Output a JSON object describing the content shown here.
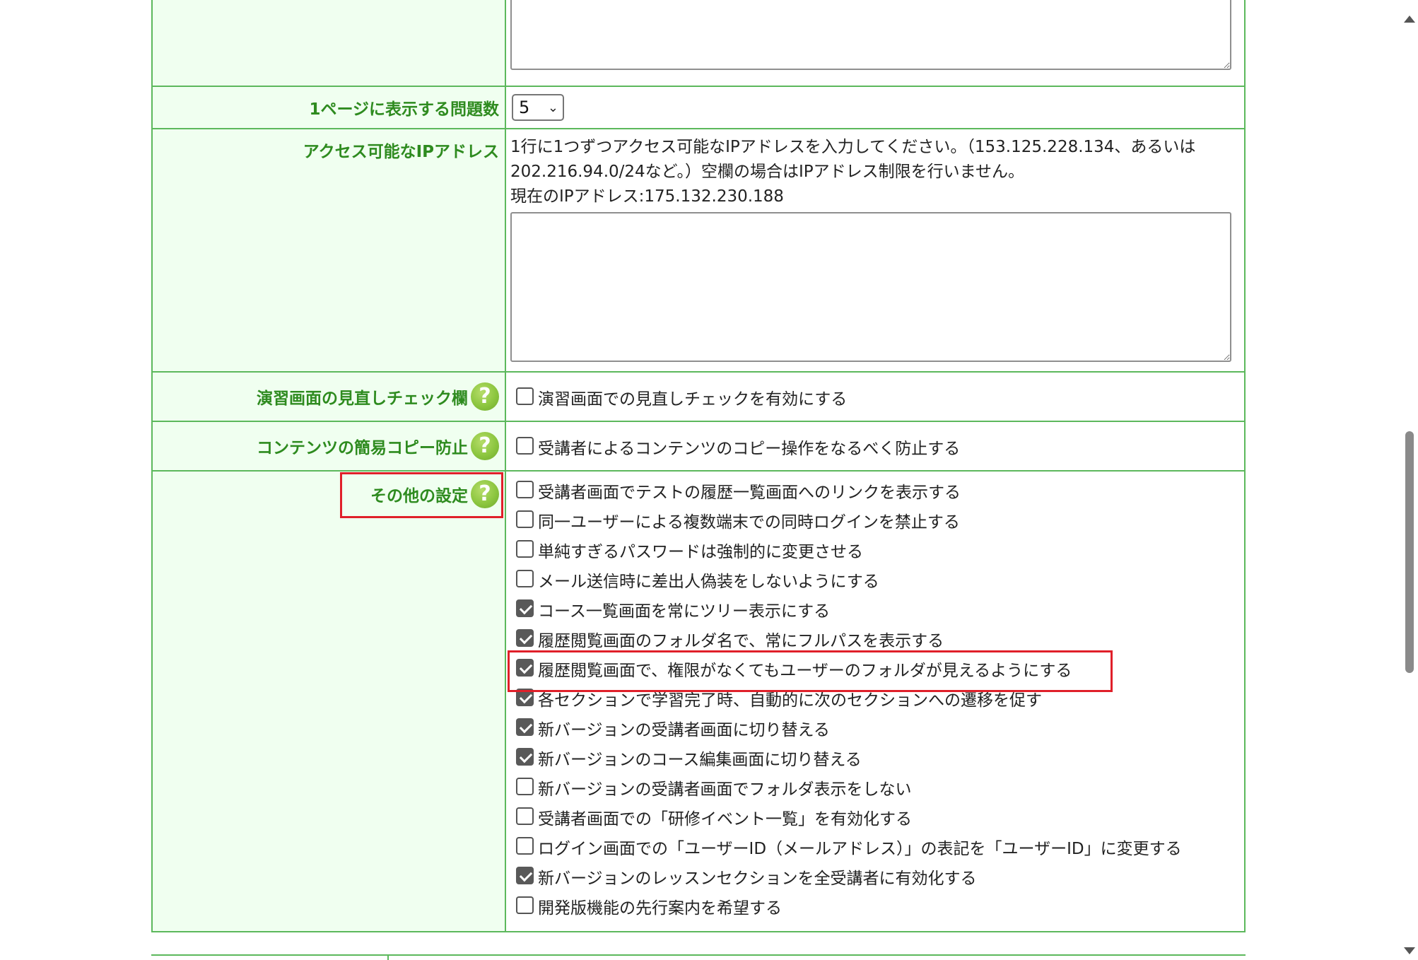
{
  "rows": {
    "questions_per_page": {
      "label": "1ページに表示する問題数",
      "select_value": "5"
    },
    "ip_address": {
      "label": "アクセス可能なIPアドレス",
      "desc_line1": "1行に1つずつアクセス可能なIPアドレスを入力してください。（153.125.228.134、あるいは",
      "desc_line2": "202.216.94.0/24など。）空欄の場合はIPアドレス制限を行いません。",
      "current_ip": "現在のIPアドレス:175.132.230.188",
      "textarea_value": ""
    },
    "review_check": {
      "label": "演習画面の見直しチェック欄",
      "option": "演習画面での見直しチェックを有効にする",
      "checked": false
    },
    "copy_protect": {
      "label": "コンテンツの簡易コピー防止",
      "option": "受講者によるコンテンツのコピー操作をなるべく防止する",
      "checked": false
    },
    "other": {
      "label": "その他の設定",
      "options": [
        {
          "label": "受講者画面でテストの履歴一覧画面へのリンクを表示する",
          "checked": false
        },
        {
          "label": "同一ユーザーによる複数端末での同時ログインを禁止する",
          "checked": false
        },
        {
          "label": "単純すぎるパスワードは強制的に変更させる",
          "checked": false
        },
        {
          "label": "メール送信時に差出人偽装をしないようにする",
          "checked": false
        },
        {
          "label": "コース一覧画面を常にツリー表示にする",
          "checked": true
        },
        {
          "label": "履歴閲覧画面のフォルダ名で、常にフルパスを表示する",
          "checked": true
        },
        {
          "label": "履歴閲覧画面で、権限がなくてもユーザーのフォルダが見えるようにする",
          "checked": true
        },
        {
          "label": "各セクションで学習完了時、自動的に次のセクションへの遷移を促す",
          "checked": true
        },
        {
          "label": "新バージョンの受講者画面に切り替える",
          "checked": true
        },
        {
          "label": "新バージョンのコース編集画面に切り替える",
          "checked": true
        },
        {
          "label": "新バージョンの受講者画面でフォルダ表示をしない",
          "checked": false
        },
        {
          "label": "受講者画面での「研修イベント一覧」を有効化する",
          "checked": false
        },
        {
          "label": "ログイン画面での「ユーザーID（メールアドレス）」の表記を「ユーザーID」に変更する",
          "checked": false
        },
        {
          "label": "新バージョンのレッスンセクションを全受講者に有効化する",
          "checked": true
        },
        {
          "label": "開発版機能の先行案内を希望する",
          "checked": false
        }
      ]
    }
  },
  "help_icon_glyph": "?",
  "colors": {
    "label_text": "#2e8b1f",
    "label_bg": "#f0fff0",
    "border": "#5cb85c",
    "highlight": "#e0202a",
    "help_icon": "#8cc63f"
  }
}
